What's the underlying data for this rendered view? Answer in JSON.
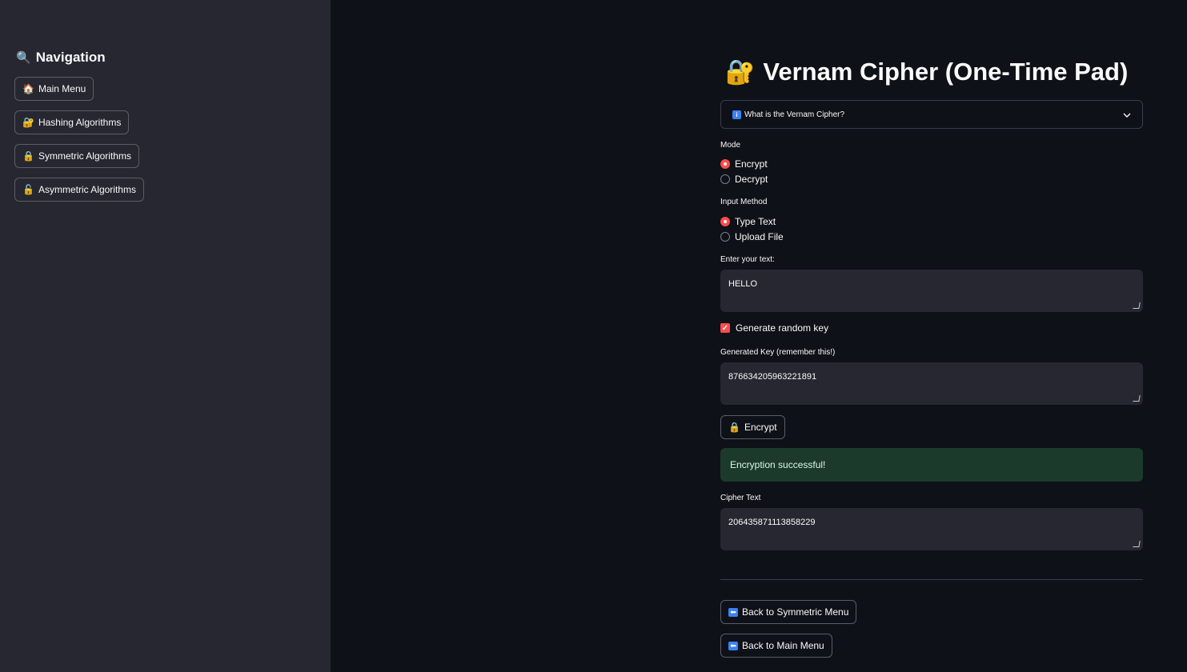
{
  "sidebar": {
    "title": "Navigation",
    "title_icon": "magnifier-icon",
    "items": [
      {
        "label": "Main Menu",
        "icon": "house-icon",
        "icon_char": "🏠"
      },
      {
        "label": "Hashing Algorithms",
        "icon": "locked-with-key-icon",
        "icon_char": "🔐"
      },
      {
        "label": "Symmetric Algorithms",
        "icon": "lock-icon",
        "icon_char": "🔒"
      },
      {
        "label": "Asymmetric Algorithms",
        "icon": "unlocked-icon",
        "icon_char": "🔓"
      }
    ]
  },
  "main": {
    "title": "Vernam Cipher (One-Time Pad)",
    "title_icon": "locked-with-key-icon",
    "expander": {
      "label": "What is the Vernam Cipher?",
      "icon": "info-icon"
    },
    "mode": {
      "label": "Mode",
      "options": [
        "Encrypt",
        "Decrypt"
      ],
      "selected": "Encrypt"
    },
    "input_method": {
      "label": "Input Method",
      "options": [
        "Type Text",
        "Upload File"
      ],
      "selected": "Type Text"
    },
    "text_input": {
      "label": "Enter your text:",
      "value": "HELLO"
    },
    "random_key": {
      "label": "Generate random key",
      "checked": true
    },
    "generated_key": {
      "label": "Generated Key (remember this!)",
      "value": "876634205963221891"
    },
    "encrypt_button": {
      "label": "Encrypt",
      "icon": "lock-icon"
    },
    "success_message": "Encryption successful!",
    "cipher_text": {
      "label": "Cipher Text",
      "value": "206435871113858229"
    },
    "back_symmetric": {
      "label": "Back to Symmetric Menu",
      "icon": "left-arrow-icon"
    },
    "back_main": {
      "label": "Back to Main Menu",
      "icon": "left-arrow-icon"
    }
  },
  "colors": {
    "background": "#0e1117",
    "sidebar": "#262730",
    "accent": "#ff4b4b",
    "success_bg": "#1b3a2b"
  }
}
